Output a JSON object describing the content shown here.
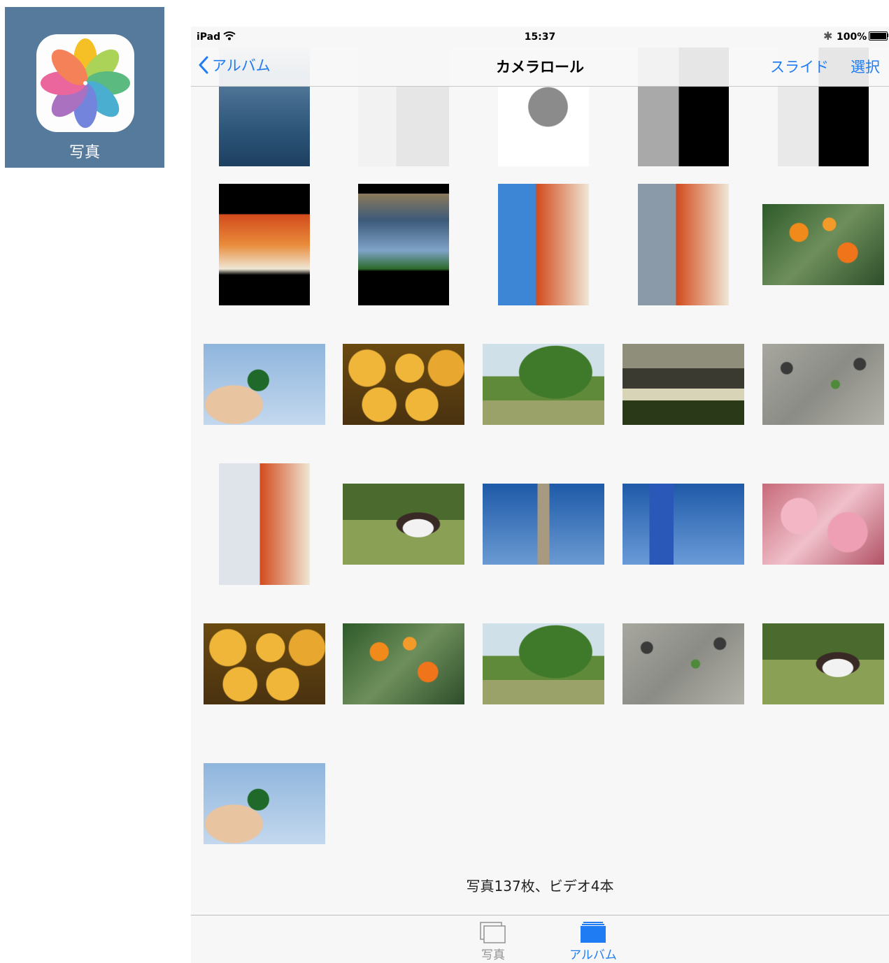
{
  "app_icon": {
    "label": "写真",
    "tile_color": "#567a9c"
  },
  "status_bar": {
    "device": "iPad",
    "time": "15:37",
    "battery": "100%",
    "battery_level": 1.0
  },
  "nav": {
    "back_label": "アルバム",
    "title": "カメラロール",
    "slide_label": "スライド",
    "select_label": "選択"
  },
  "photos": [
    {
      "subject": "ipad-home-screen"
    },
    {
      "subject": "ipad-settings-screenshot"
    },
    {
      "subject": "airprint-logo"
    },
    {
      "subject": "ipad-screenshot-gray"
    },
    {
      "subject": "ipad-screenshot-list"
    },
    {
      "subject": "autumn-leaves-screenshot"
    },
    {
      "subject": "photo-grid-screenshot"
    },
    {
      "subject": "leaves-with-sidebar-screenshot"
    },
    {
      "subject": "leaves-with-menu-screenshot"
    },
    {
      "subject": "orange-flowers"
    },
    {
      "subject": "clover-in-hand"
    },
    {
      "subject": "pumpkins"
    },
    {
      "subject": "park-tree"
    },
    {
      "subject": "city-lake-birds"
    },
    {
      "subject": "stars-on-pavement"
    },
    {
      "subject": "leaves-with-list-screenshot"
    },
    {
      "subject": "dog-in-park"
    },
    {
      "subject": "tree-sky"
    },
    {
      "subject": "parking-sign-palms"
    },
    {
      "subject": "cherry-blossoms"
    },
    {
      "subject": "pumpkins"
    },
    {
      "subject": "orange-flowers"
    },
    {
      "subject": "park-tree"
    },
    {
      "subject": "stars-on-pavement"
    },
    {
      "subject": "dog-in-park"
    },
    {
      "subject": "clover-in-hand"
    }
  ],
  "footer": {
    "photo_count": "写真137枚、ビデオ4本"
  },
  "tabs": [
    {
      "label": "写真",
      "icon": "photos-stack-icon",
      "selected": false
    },
    {
      "label": "アルバム",
      "icon": "albums-icon",
      "selected": true
    }
  ],
  "colors": {
    "accent": "#1f7cf3",
    "bar": "#f7f7f7",
    "inactive": "#929292"
  }
}
